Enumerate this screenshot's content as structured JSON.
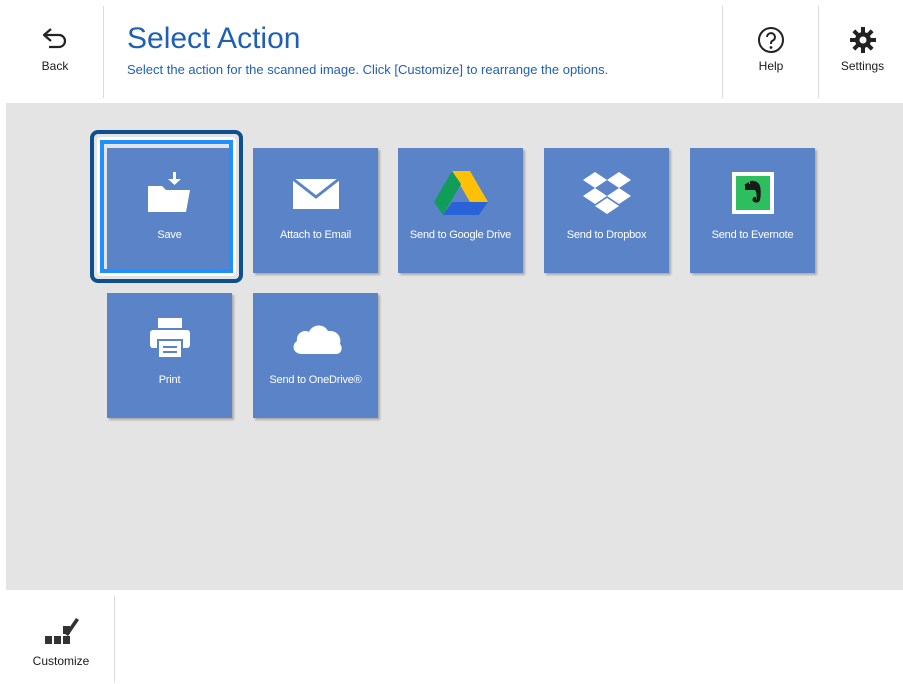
{
  "header": {
    "back_label": "Back",
    "title": "Select Action",
    "subtitle": "Select the action for the scanned image. Click [Customize] to rearrange the options.",
    "help_label": "Help",
    "settings_label": "Settings"
  },
  "actions": [
    {
      "label": "Save",
      "icon": "folder-download-icon",
      "selected": true
    },
    {
      "label": "Attach to Email",
      "icon": "envelope-icon"
    },
    {
      "label": "Send to Google Drive",
      "icon": "google-drive-icon"
    },
    {
      "label": "Send to Dropbox",
      "icon": "dropbox-icon"
    },
    {
      "label": "Send to Evernote",
      "icon": "evernote-icon"
    },
    {
      "label": "Print",
      "icon": "printer-icon"
    },
    {
      "label": "Send to OneDrive®",
      "icon": "onedrive-cloud-icon"
    }
  ],
  "footer": {
    "customize_label": "Customize"
  },
  "colors": {
    "accent": "#1f5fb5",
    "tile": "#5b84c8",
    "selection": "#1e90ff",
    "panel": "#e4e4e4"
  }
}
